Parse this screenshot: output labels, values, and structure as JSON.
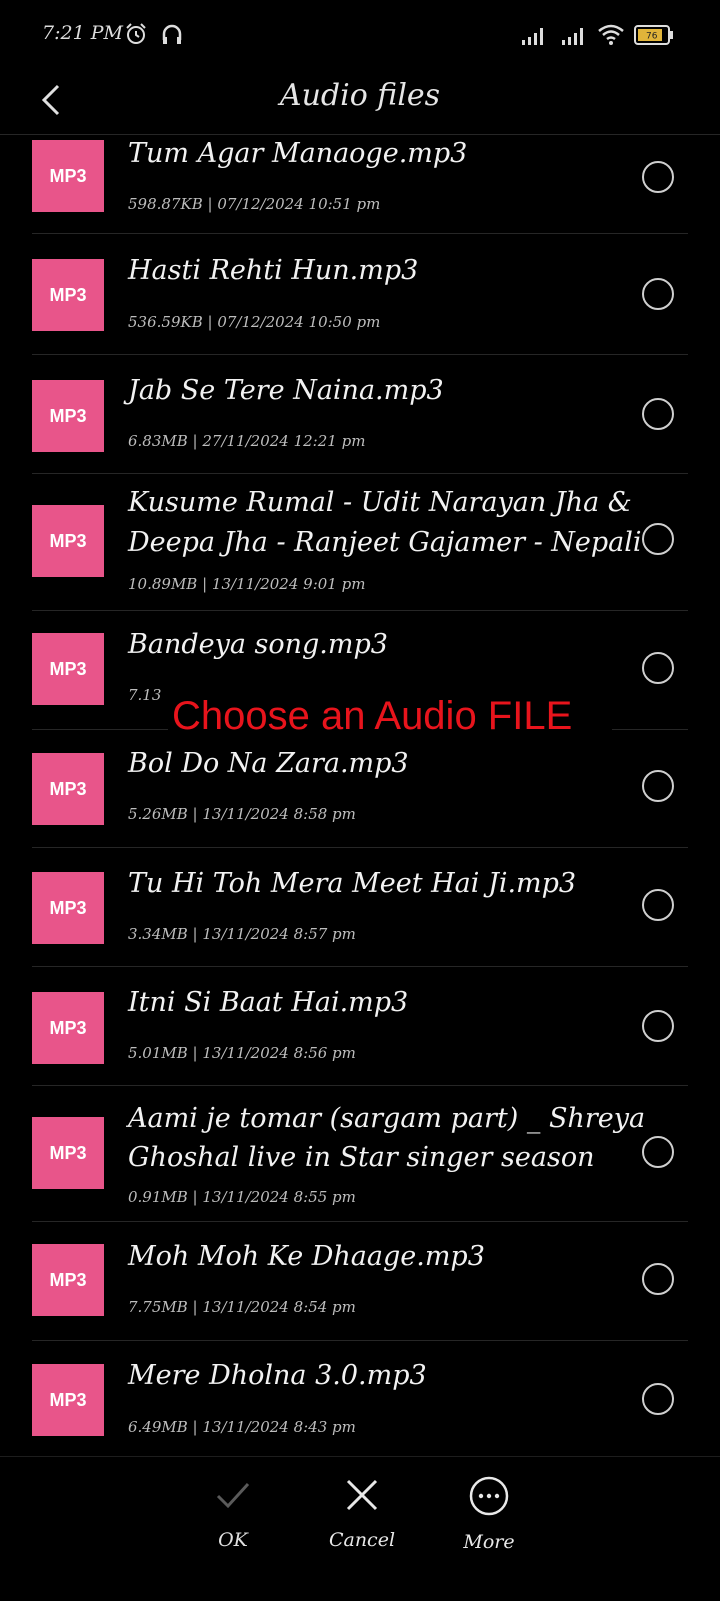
{
  "status_bar": {
    "time": "7:21 PM",
    "battery_level": "76"
  },
  "header": {
    "title": "Audio files"
  },
  "overlay": {
    "text": "Choose an Audio FILE"
  },
  "files": [
    {
      "badge": "MP3",
      "name": "Tum Agar Manaoge.mp3",
      "size": "598.87KB",
      "date": "07/12/2024 10:51 pm"
    },
    {
      "badge": "MP3",
      "name": "Hasti Rehti Hun.mp3",
      "size": "536.59KB",
      "date": "07/12/2024 10:50 pm"
    },
    {
      "badge": "MP3",
      "name": "Jab Se Tere Naina.mp3",
      "size": "6.83MB",
      "date": "27/11/2024 12:21 pm"
    },
    {
      "badge": "MP3",
      "name": "Kusume Rumal - Udit Narayan Jha & Deepa Jha - Ranjeet Gajamer - Nepali",
      "size": "10.89MB",
      "date": "13/11/2024 9:01 pm"
    },
    {
      "badge": "MP3",
      "name": "Bandeya song.mp3",
      "size": "7.13",
      "date": ""
    },
    {
      "badge": "MP3",
      "name": "Bol Do Na Zara.mp3",
      "size": "5.26MB",
      "date": "13/11/2024 8:58 pm"
    },
    {
      "badge": "MP3",
      "name": "Tu Hi Toh Mera Meet Hai Ji.mp3",
      "size": "3.34MB",
      "date": "13/11/2024 8:57 pm"
    },
    {
      "badge": "MP3",
      "name": "Itni Si Baat Hai.mp3",
      "size": "5.01MB",
      "date": "13/11/2024 8:56 pm"
    },
    {
      "badge": "MP3",
      "name": "Aami je tomar (sargam part) _ Shreya Ghoshal live in Star singer season",
      "size": "0.91MB",
      "date": "13/11/2024 8:55 pm"
    },
    {
      "badge": "MP3",
      "name": "Moh Moh Ke Dhaage.mp3",
      "size": "7.75MB",
      "date": "13/11/2024 8:54 pm"
    },
    {
      "badge": "MP3",
      "name": "Mere Dholna 3.0.mp3",
      "size": "6.49MB",
      "date": "13/11/2024 8:43 pm"
    }
  ],
  "bottom_bar": {
    "ok_label": "OK",
    "cancel_label": "Cancel",
    "more_label": "More"
  },
  "colors": {
    "badge": "#e8558a",
    "overlay_text": "#e8141c",
    "background": "#000000"
  }
}
